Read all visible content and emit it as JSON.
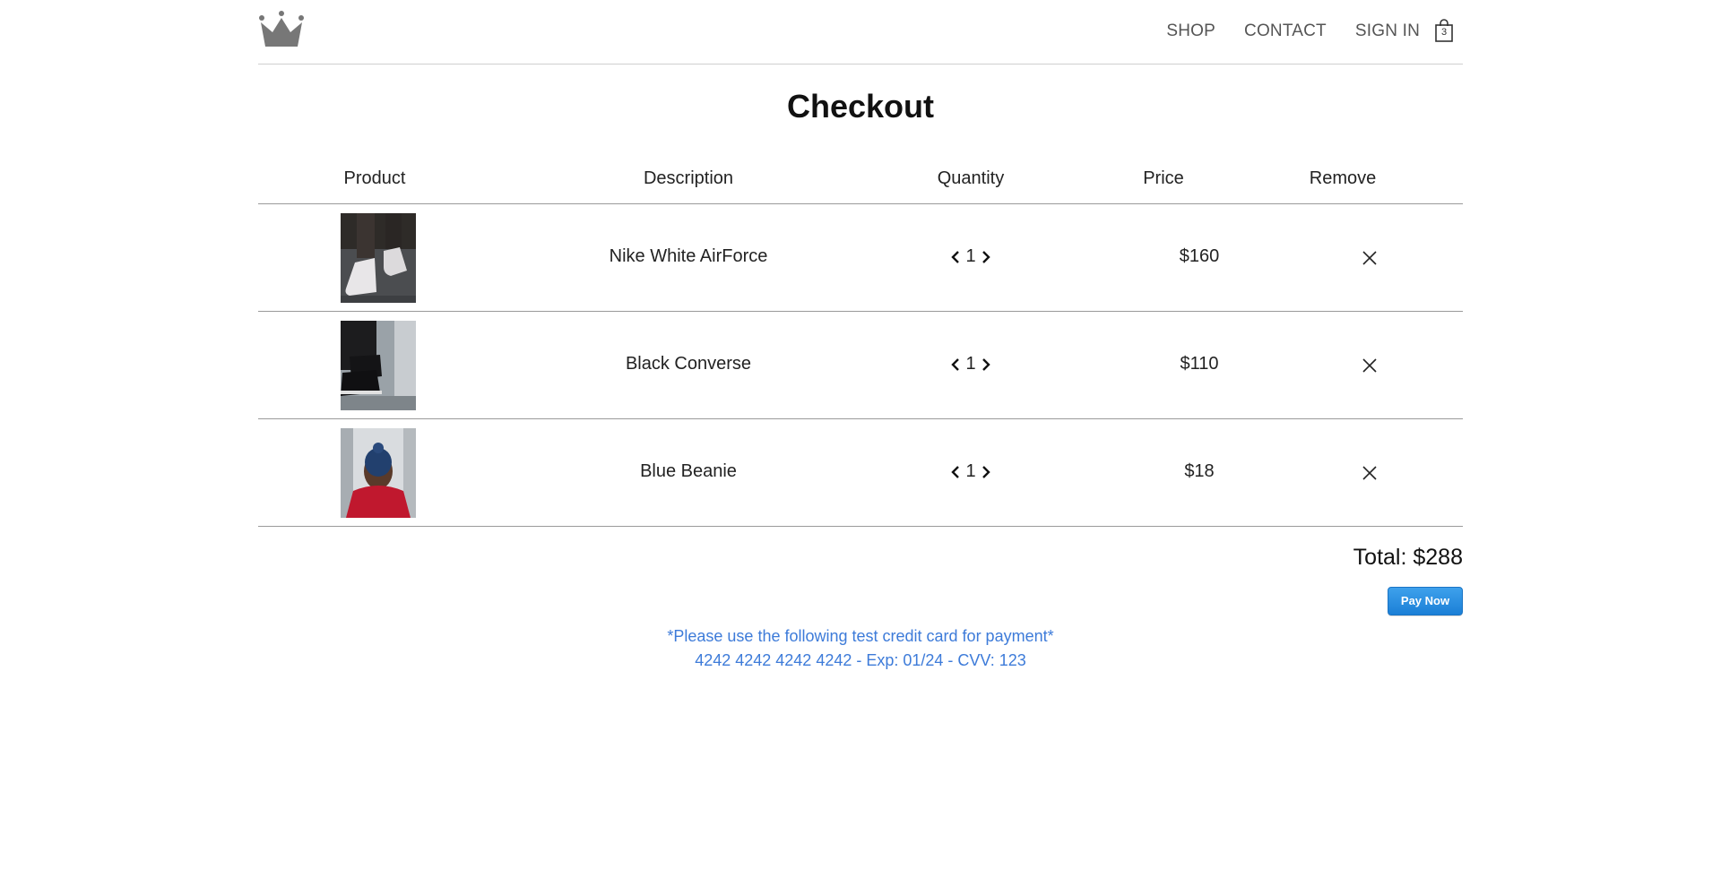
{
  "header": {
    "nav": [
      "SHOP",
      "CONTACT",
      "SIGN IN"
    ],
    "cart_count": "3",
    "colors": {
      "logo": "#777777",
      "nav_text": "#555555"
    }
  },
  "page": {
    "title": "Checkout"
  },
  "table": {
    "headers": [
      "Product",
      "Description",
      "Quantity",
      "Price",
      "Remove"
    ],
    "rows": [
      {
        "description": "Nike White AirForce",
        "quantity": "1",
        "price": "$160",
        "image": "white-sneakers-photo"
      },
      {
        "description": "Black Converse",
        "quantity": "1",
        "price": "$110",
        "image": "black-converse-photo"
      },
      {
        "description": "Blue Beanie",
        "quantity": "1",
        "price": "$18",
        "image": "blue-beanie-photo"
      }
    ]
  },
  "summary": {
    "total": "Total: $288",
    "pay_button": "Pay Now"
  },
  "note": {
    "line1": "*Please use the following test credit card for payment*",
    "line2": "4242 4242 4242 4242 - Exp: 01/24 - CVV: 123",
    "color": "#3d7bd9"
  },
  "accent": "#1b7fd6"
}
